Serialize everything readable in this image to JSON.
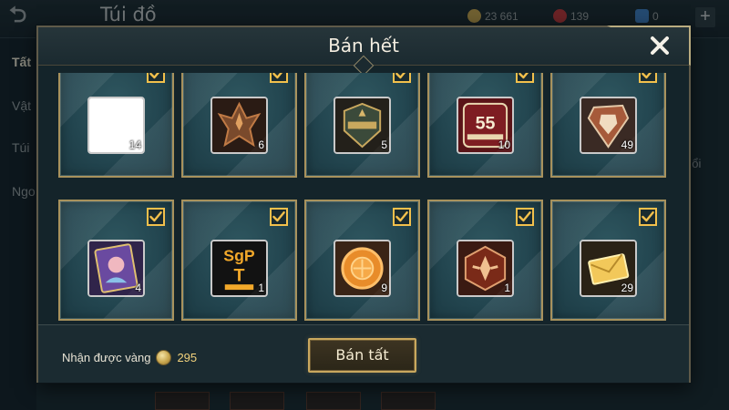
{
  "background": {
    "title": "Túi đồ",
    "stats": [
      {
        "value": "23 661",
        "color": "#c9a64e",
        "icon": "gold-coin-icon"
      },
      {
        "value": "139",
        "color": "#c0383a",
        "icon": "ruby-icon"
      },
      {
        "value": "0",
        "color": "#3f7ec2",
        "icon": "ticket-icon"
      }
    ],
    "sidebar": [
      "Tất",
      "Vật",
      "Túi",
      "Ngo"
    ],
    "right_text": "đổi"
  },
  "dialog": {
    "title": "Bán hết",
    "items": [
      {
        "qty": "14",
        "icon": "blank-item-icon",
        "checked": true
      },
      {
        "qty": "6",
        "icon": "dark-crest-icon",
        "checked": true
      },
      {
        "qty": "5",
        "icon": "danh-vong-badge-icon",
        "checked": true
      },
      {
        "qty": "10",
        "icon": "give-me-five-icon",
        "checked": true
      },
      {
        "qty": "49",
        "icon": "armor-shard-icon",
        "checked": true
      },
      {
        "qty": "4",
        "icon": "hero-card-icon",
        "checked": true
      },
      {
        "qty": "1",
        "icon": "sgp-sticker-icon",
        "checked": true
      },
      {
        "qty": "9",
        "icon": "mooncake-icon",
        "checked": true
      },
      {
        "qty": "1",
        "icon": "rank-emblem-icon",
        "checked": true
      },
      {
        "qty": "29",
        "icon": "envelope-icon",
        "checked": true
      }
    ],
    "footer": {
      "reward_label": "Nhận được vàng",
      "reward_value": "295",
      "sell_all_label": "Bán tất"
    }
  },
  "colors": {
    "gold_border": "#a8925d",
    "check": "#f2c04c",
    "tile": "#234650"
  }
}
